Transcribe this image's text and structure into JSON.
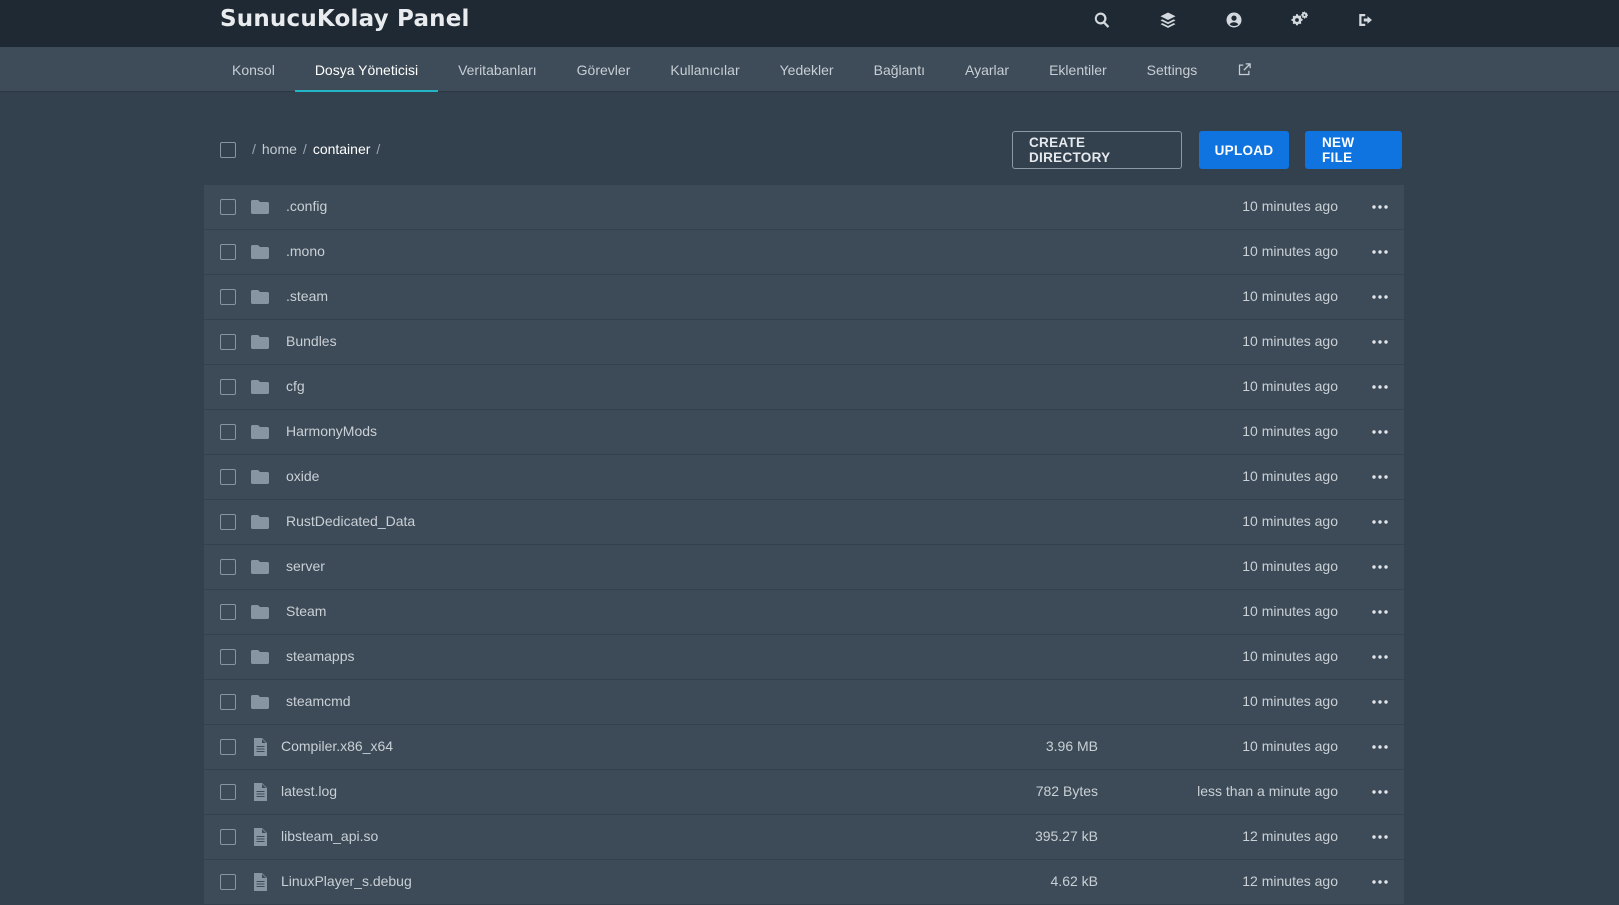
{
  "app": {
    "title": "SunucuKolay Panel"
  },
  "top_icons": [
    "search-icon",
    "layers-icon",
    "user-circle-icon",
    "gears-icon",
    "sign-out-icon"
  ],
  "tabs": [
    {
      "label": "Konsol"
    },
    {
      "label": "Dosya Yöneticisi",
      "active": true
    },
    {
      "label": "Veritabanları"
    },
    {
      "label": "Görevler"
    },
    {
      "label": "Kullanıcılar"
    },
    {
      "label": "Yedekler"
    },
    {
      "label": "Bağlantı"
    },
    {
      "label": "Ayarlar"
    },
    {
      "label": "Eklentiler"
    },
    {
      "label": "Settings"
    }
  ],
  "breadcrumb": {
    "sep": "/",
    "home": "home",
    "current": "container"
  },
  "toolbar": {
    "create_directory": "CREATE DIRECTORY",
    "upload": "UPLOAD",
    "new_file": "NEW FILE"
  },
  "colors": {
    "accent": "#22b5c8",
    "primary": "#1074e0",
    "background": "#33404d",
    "row": "#3d4a57"
  },
  "files": [
    {
      "type": "directory",
      "name": ".config",
      "size": "",
      "modified": "10 minutes ago"
    },
    {
      "type": "directory",
      "name": ".mono",
      "size": "",
      "modified": "10 minutes ago"
    },
    {
      "type": "directory",
      "name": ".steam",
      "size": "",
      "modified": "10 minutes ago"
    },
    {
      "type": "directory",
      "name": "Bundles",
      "size": "",
      "modified": "10 minutes ago"
    },
    {
      "type": "directory",
      "name": "cfg",
      "size": "",
      "modified": "10 minutes ago"
    },
    {
      "type": "directory",
      "name": "HarmonyMods",
      "size": "",
      "modified": "10 minutes ago"
    },
    {
      "type": "directory",
      "name": "oxide",
      "size": "",
      "modified": "10 minutes ago"
    },
    {
      "type": "directory",
      "name": "RustDedicated_Data",
      "size": "",
      "modified": "10 minutes ago"
    },
    {
      "type": "directory",
      "name": "server",
      "size": "",
      "modified": "10 minutes ago"
    },
    {
      "type": "directory",
      "name": "Steam",
      "size": "",
      "modified": "10 minutes ago"
    },
    {
      "type": "directory",
      "name": "steamapps",
      "size": "",
      "modified": "10 minutes ago"
    },
    {
      "type": "directory",
      "name": "steamcmd",
      "size": "",
      "modified": "10 minutes ago"
    },
    {
      "type": "file",
      "name": "Compiler.x86_x64",
      "size": "3.96 MB",
      "modified": "10 minutes ago"
    },
    {
      "type": "file",
      "name": "latest.log",
      "size": "782 Bytes",
      "modified": "less than a minute ago"
    },
    {
      "type": "file",
      "name": "libsteam_api.so",
      "size": "395.27 kB",
      "modified": "12 minutes ago"
    },
    {
      "type": "file",
      "name": "LinuxPlayer_s.debug",
      "size": "4.62 kB",
      "modified": "12 minutes ago"
    }
  ]
}
